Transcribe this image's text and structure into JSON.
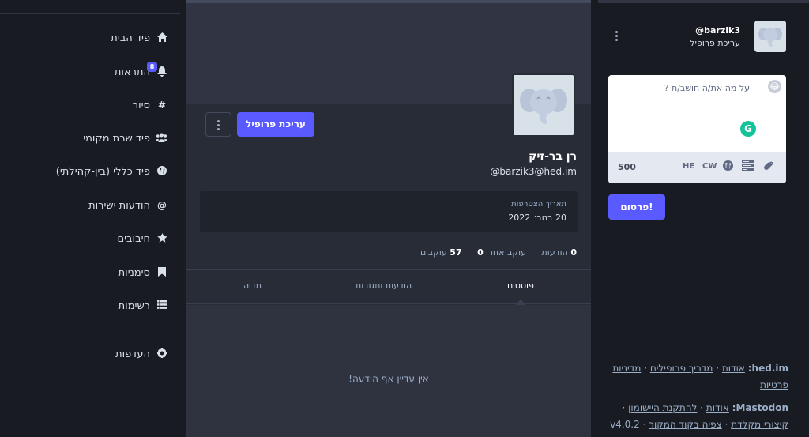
{
  "compose": {
    "handle": "@barzik3",
    "edit_profile": "עריכת פרופיל",
    "placeholder": "על מה את/ה חושב/ת ?",
    "char_count": "500",
    "lang": "HE",
    "cw": "CW",
    "publish": "פרסום!"
  },
  "footer": {
    "site": "hed.im:",
    "about": "אודות",
    "profiles_dir": "מדריך פרופילים",
    "policy": "מדיניות פרטיות",
    "mastodon": "Mastodon:",
    "about2": "אודות",
    "get_app": "להתקנת היישומון",
    "shortcuts": "קיצורי מקלדת",
    "source": "צפיה בקוד המקור",
    "version": "v4.0.2"
  },
  "profile": {
    "edit_button": "עריכת פרופיל",
    "display_name": "רן בר-זיק",
    "acct": "@barzik3@hed.im",
    "joined_label": "תאריך הצטרפות",
    "joined_date": "20 בנוב׳ 2022",
    "stats": {
      "posts_count": "0",
      "posts_label": "הודעות",
      "following_count": "0",
      "following_label": "עוקב אחרי",
      "followers_count": "57",
      "followers_label": "עוקבים"
    },
    "tabs": [
      "פוסטים",
      "הודעות ותגובות",
      "מדיה"
    ],
    "empty": "אין עדיין אף הודעה!"
  },
  "nav": {
    "items": [
      {
        "label": "פיד הבית",
        "icon": "home-icon"
      },
      {
        "label": "התראות",
        "icon": "bell-icon",
        "badge": "8"
      },
      {
        "label": "סיור",
        "icon": "hashtag-icon"
      },
      {
        "label": "פיד שרת מקומי",
        "icon": "users-icon"
      },
      {
        "label": "פיד כללי (בין-קהילתי)",
        "icon": "globe-icon"
      },
      {
        "label": "הודעות ישירות",
        "icon": "at-icon"
      },
      {
        "label": "חיבובים",
        "icon": "star-icon"
      },
      {
        "label": "סימניות",
        "icon": "bookmark-icon"
      },
      {
        "label": "רשימות",
        "icon": "list-icon"
      }
    ],
    "settings": {
      "label": "העדפות",
      "icon": "gear-icon"
    }
  },
  "colors": {
    "accent": "#595aff",
    "bg": "#191b22",
    "panel": "#282c37"
  }
}
